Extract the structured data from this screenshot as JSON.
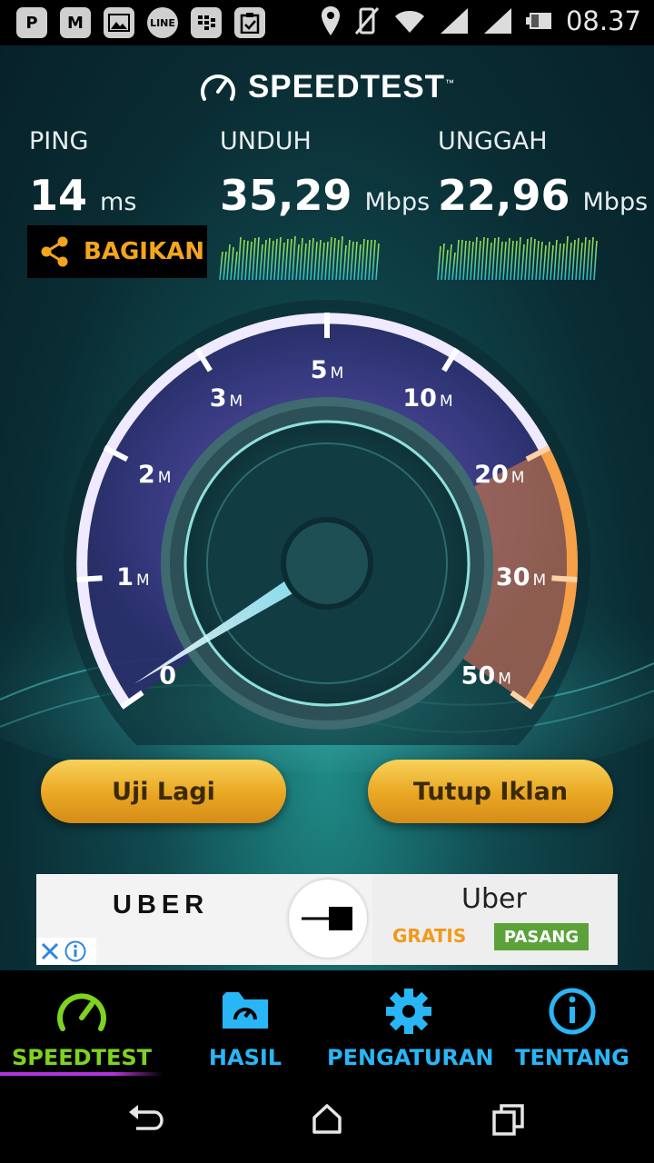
{
  "status_bar": {
    "time": "08.37",
    "icons": [
      "pinterest-icon",
      "gmail-icon",
      "gallery-icon",
      "line-icon",
      "bbm-icon",
      "clipboard-icon",
      "location-icon",
      "mute-icon",
      "wifi-icon",
      "signal-icon",
      "signal-icon",
      "battery-icon"
    ],
    "line_text": "LINE"
  },
  "app": {
    "title": "SPEEDTEST",
    "trademark": "™"
  },
  "results": {
    "ping": {
      "label": "PING",
      "value": "14",
      "unit": "ms"
    },
    "download": {
      "label": "UNDUH",
      "value": "35,29",
      "unit": "Mbps"
    },
    "upload": {
      "label": "UNGGAH",
      "value": "22,96",
      "unit": "Mbps"
    }
  },
  "share_button": {
    "label": "BAGIKAN",
    "icon": "share-icon"
  },
  "gauge": {
    "ticks": [
      {
        "num": "0",
        "unit": ""
      },
      {
        "num": "1",
        "unit": "M"
      },
      {
        "num": "2",
        "unit": "M"
      },
      {
        "num": "3",
        "unit": "M"
      },
      {
        "num": "5",
        "unit": "M"
      },
      {
        "num": "10",
        "unit": "M"
      },
      {
        "num": "20",
        "unit": "M"
      },
      {
        "num": "30",
        "unit": "M"
      },
      {
        "num": "50",
        "unit": "M"
      }
    ],
    "needle_value_mbps": 0
  },
  "buttons": {
    "retest": "Uji Lagi",
    "close_ad": "Tutup Iklan"
  },
  "ad": {
    "logo_text": "UBER",
    "app_name": "Uber",
    "price": "GRATIS",
    "install": "PASANG"
  },
  "tabs": [
    {
      "label": "SPEEDTEST",
      "icon": "speedometer-icon",
      "active": true
    },
    {
      "label": "HASIL",
      "icon": "results-folder-icon",
      "active": false
    },
    {
      "label": "PENGATURAN",
      "icon": "gear-icon",
      "active": false
    },
    {
      "label": "TENTANG",
      "icon": "info-icon",
      "active": false
    }
  ],
  "colors": {
    "accent_green": "#7ed321",
    "tab_blue": "#29b6f6",
    "orange": "#f4a51e",
    "gauge_purple": "#6a4fb0",
    "gauge_orange": "#f08a3a"
  }
}
